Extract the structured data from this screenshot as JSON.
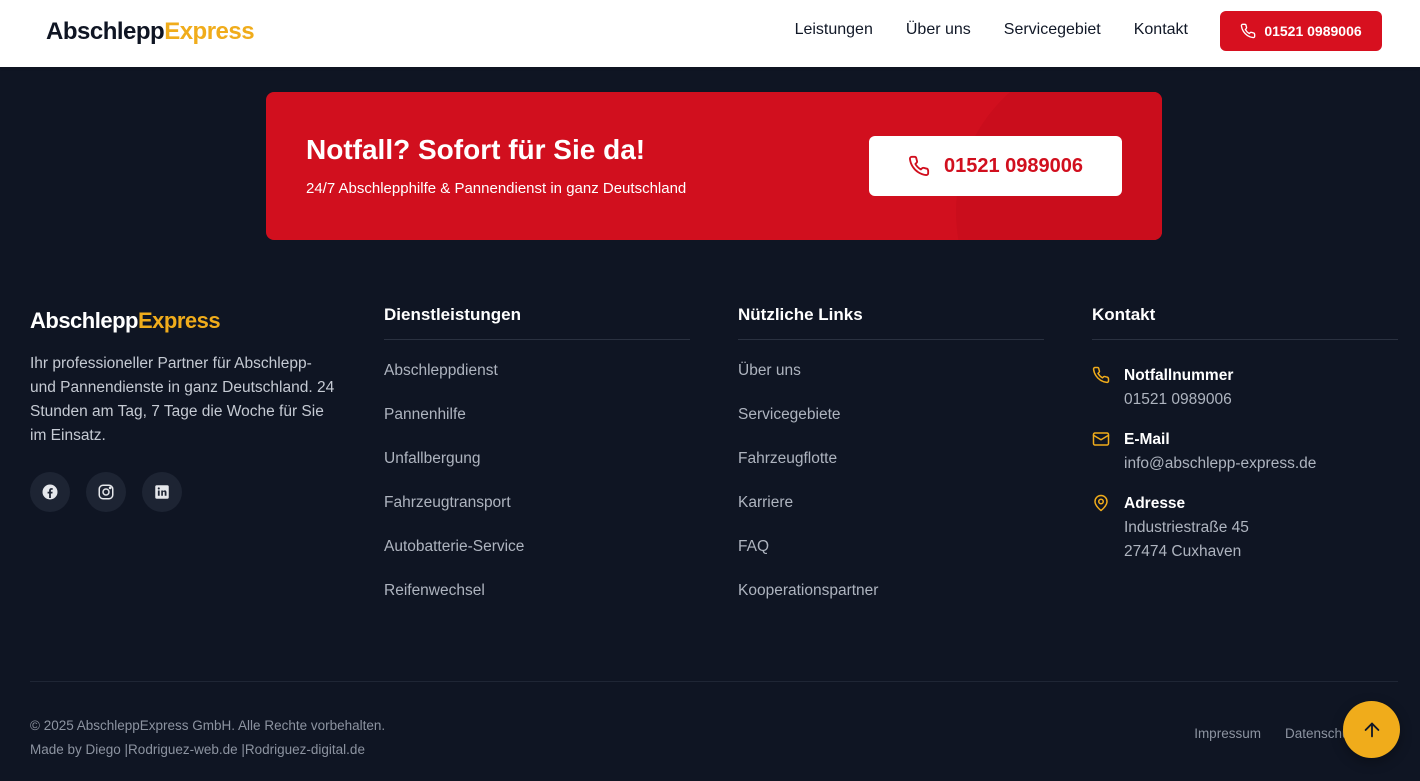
{
  "header": {
    "logo_part1": "Abschlepp",
    "logo_part2": "Express",
    "nav": [
      "Leistungen",
      "Über uns",
      "Servicegebiet",
      "Kontakt"
    ],
    "phone_button": "01521 0989006"
  },
  "banner": {
    "title": "Notfall? Sofort für Sie da!",
    "subtitle": "24/7 Abschlepphilfe & Pannendienst in ganz Deutschland",
    "phone": "01521 0989006"
  },
  "footer": {
    "logo_part1": "Abschlepp",
    "logo_part2": "Express",
    "about": "Ihr professioneller Partner für Abschlepp- und Pannendienste in ganz Deutschland. 24 Stunden am Tag, 7 Tage die Woche für Sie im Einsatz.",
    "services_title": "Dienstleistungen",
    "services": [
      "Abschleppdienst",
      "Pannenhilfe",
      "Unfallbergung",
      "Fahrzeugtransport",
      "Autobatterie-Service",
      "Reifenwechsel"
    ],
    "links_title": "Nützliche Links",
    "links": [
      "Über uns",
      "Servicegebiete",
      "Fahrzeugflotte",
      "Karriere",
      "FAQ",
      "Kooperationspartner"
    ],
    "contact_title": "Kontakt",
    "contact": {
      "phone_label": "Notfallnummer",
      "phone": "01521 0989006",
      "email_label": "E-Mail",
      "email": "info@abschlepp-express.de",
      "address_label": "Adresse",
      "address_line1": "Industriestraße 45",
      "address_line2": "27474 Cuxhaven"
    },
    "copyright": "© 2025 AbschleppExpress GmbH. Alle Rechte vorbehalten.",
    "made_by": "Made by Diego |Rodriguez-web.de |Rodriguez-digital.de",
    "legal": [
      "Impressum",
      "Datenschutz"
    ]
  },
  "colors": {
    "brand_red": "#d10f1e",
    "brand_yellow": "#f0ac1b",
    "footer_bg": "#0f1523"
  },
  "icons": [
    "phone-icon",
    "mail-icon",
    "map-pin-icon",
    "facebook-icon",
    "instagram-icon",
    "linkedin-icon",
    "arrow-up-icon"
  ]
}
